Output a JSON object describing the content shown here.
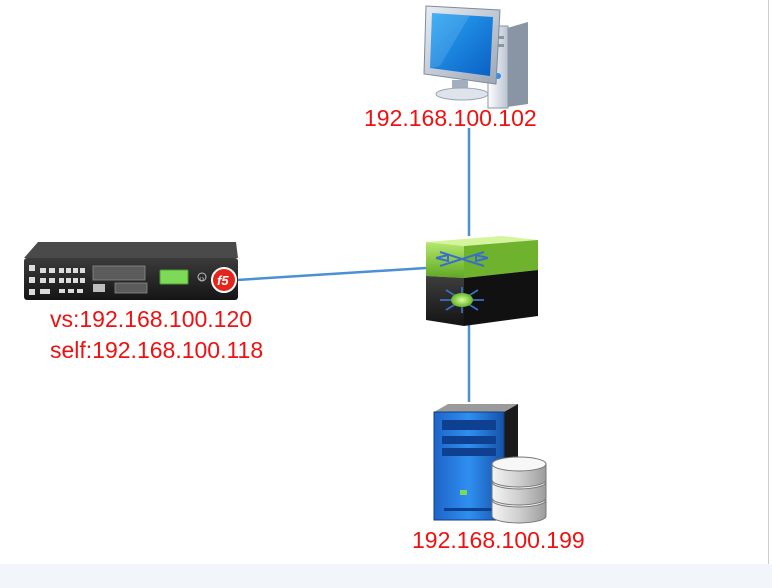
{
  "diagram": {
    "colors": {
      "link": "#4a90d6",
      "label_text": "#ee1111",
      "background": "#ffffff",
      "footer": "#f2f5fa"
    },
    "nodes": {
      "pc": {
        "icon": "desktop-computer-icon",
        "label": "192.168.100.102"
      },
      "switch": {
        "icon": "network-switch-icon"
      },
      "f5": {
        "icon": "f5-bigip-appliance-icon",
        "vs_label": "vs:192.168.100.120",
        "self_label": "self:192.168.100.118"
      },
      "server": {
        "icon": "database-server-icon",
        "label": "192.168.100.199"
      }
    },
    "links": [
      {
        "from": "pc",
        "to": "switch"
      },
      {
        "from": "f5",
        "to": "switch"
      },
      {
        "from": "switch",
        "to": "server"
      }
    ]
  }
}
